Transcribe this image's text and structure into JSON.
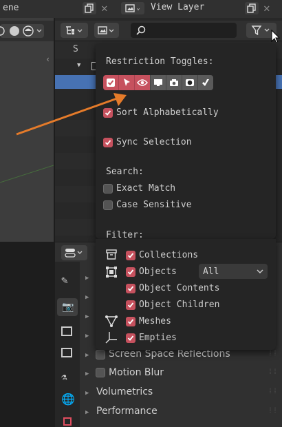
{
  "header": {
    "left_editor": "ene",
    "right_editor": "View Layer"
  },
  "outliner": {
    "row_letter": "S"
  },
  "filter_popup": {
    "restriction_title": "Restriction Toggles:",
    "sort_alphabetically": "Sort Alphabetically",
    "sync_selection": "Sync Selection",
    "search_title": "Search:",
    "exact_match": "Exact Match",
    "case_sensitive": "Case Sensitive",
    "filter_title": "Filter:",
    "collections": "Collections",
    "objects": "Objects",
    "objects_dropdown": "All",
    "object_contents": "Object Contents",
    "object_children": "Object Children",
    "meshes": "Meshes",
    "empties": "Empties"
  },
  "properties": {
    "screen_space_reflections": "Screen Space Reflections",
    "motion_blur": "Motion Blur",
    "volumetrics": "Volumetrics",
    "performance": "Performance"
  },
  "colors": {
    "checkbox_on": "#c6515e",
    "arrow": "#e57b2a",
    "selected_row": "#4772b3"
  },
  "icons": [
    "copy-icon",
    "close-icon",
    "image-icon",
    "search-icon",
    "filter-icon",
    "chevron-down-icon",
    "mouse-cursor-icon",
    "arrow-icon"
  ]
}
